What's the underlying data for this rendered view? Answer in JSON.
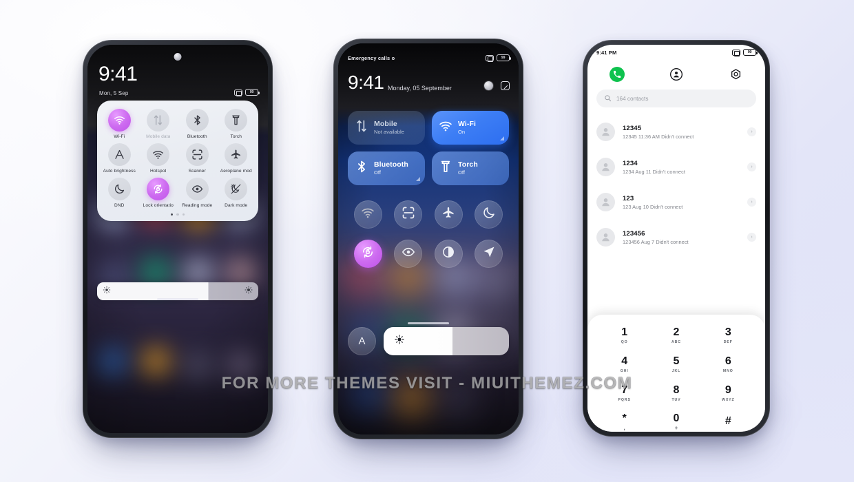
{
  "watermark": "FOR MORE THEMES VISIT - MIUITHEMEZ.COM",
  "colors": {
    "accent_purple": "#c055ea",
    "accent_blue": "#3d7ef5",
    "call_green": "#0ec24e",
    "page_background": "#e3e5f8"
  },
  "phone1": {
    "status": {
      "battery": "99",
      "alarm_icon": "alarm-icon",
      "battery_icon": "battery-icon"
    },
    "clock": "9:41",
    "date": "Mon, 5 Sep",
    "quick_settings": {
      "tiles": [
        {
          "label": "Wi-Fi",
          "icon": "wifi-icon",
          "state": "on",
          "has_arrow": true
        },
        {
          "label": "Mobile data",
          "icon": "mobile-data-icon",
          "state": "disabled",
          "has_arrow": false
        },
        {
          "label": "Bluetooth",
          "icon": "bluetooth-icon",
          "state": "off",
          "has_arrow": true
        },
        {
          "label": "Torch",
          "icon": "torch-icon",
          "state": "off",
          "has_arrow": false
        },
        {
          "label": "Auto brightness",
          "icon": "auto-brightness-icon",
          "state": "off",
          "has_arrow": false
        },
        {
          "label": "Hotspot",
          "icon": "hotspot-icon",
          "state": "off",
          "has_arrow": false
        },
        {
          "label": "Scanner",
          "icon": "scanner-icon",
          "state": "off",
          "has_arrow": false
        },
        {
          "label": "Aeroplane mod",
          "icon": "aeroplane-icon",
          "state": "off",
          "has_arrow": false
        },
        {
          "label": "DND",
          "icon": "moon-icon",
          "state": "off",
          "has_arrow": false
        },
        {
          "label": "Lock orientatio",
          "icon": "lock-rotation-icon",
          "state": "on",
          "has_arrow": false
        },
        {
          "label": "Reading mode",
          "icon": "eye-icon",
          "state": "off",
          "has_arrow": false
        },
        {
          "label": "Dark mode",
          "icon": "dark-mode-icon",
          "state": "off",
          "has_arrow": false
        }
      ],
      "page_dots": 3,
      "active_page": 1
    },
    "brightness": {
      "value_percent": 69,
      "left_icon": "auto-brightness-small-icon",
      "right_icon": "brightness-icon"
    }
  },
  "phone2": {
    "status": {
      "carrier": "Emergency calls o",
      "battery": "99"
    },
    "clock": "9:41",
    "date": "Monday, 05 September",
    "header_icons": [
      "camera-punch-icon",
      "edit-icon"
    ],
    "big_tiles": [
      {
        "title": "Mobile",
        "subtitle": "Not available",
        "icon": "mobile-data-icon",
        "state": "disabled",
        "has_arrow": false
      },
      {
        "title": "Wi-Fi",
        "subtitle": "On",
        "icon": "wifi-icon",
        "state": "active",
        "has_arrow": true
      },
      {
        "title": "Bluetooth",
        "subtitle": "Off",
        "icon": "bluetooth-icon",
        "state": "semi",
        "has_arrow": true
      },
      {
        "title": "Torch",
        "subtitle": "Off",
        "icon": "torch-icon",
        "state": "semi",
        "has_arrow": false
      }
    ],
    "round_tiles": [
      {
        "icon": "hotspot-icon",
        "state": "dim"
      },
      {
        "icon": "scanner-icon",
        "state": "off"
      },
      {
        "icon": "aeroplane-icon",
        "state": "off"
      },
      {
        "icon": "moon-icon",
        "state": "off"
      },
      {
        "icon": "lock-rotation-icon",
        "state": "on"
      },
      {
        "icon": "eye-icon",
        "state": "off"
      },
      {
        "icon": "contrast-icon",
        "state": "off"
      },
      {
        "icon": "location-icon",
        "state": "off"
      }
    ],
    "auto_brightness_label": "A",
    "brightness": {
      "value_percent": 55,
      "icon": "brightness-icon"
    }
  },
  "phone3": {
    "status": {
      "time": "9:41 PM",
      "battery": "99"
    },
    "tabs": [
      {
        "name": "calls",
        "icon": "phone-icon",
        "active": true
      },
      {
        "name": "contacts",
        "icon": "contact-icon",
        "active": false
      },
      {
        "name": "settings",
        "icon": "gear-icon",
        "active": false
      }
    ],
    "search": {
      "placeholder": "164 contacts",
      "icon": "search-icon"
    },
    "call_log": [
      {
        "name": "12345",
        "detail": "12345 11:36 AM Didn't connect"
      },
      {
        "name": "1234",
        "detail": "1234 Aug 11 Didn't connect"
      },
      {
        "name": "123",
        "detail": "123 Aug 10 Didn't connect"
      },
      {
        "name": "123456",
        "detail": "123456 Aug 7 Didn't connect"
      }
    ],
    "dialpad": [
      {
        "digit": "1",
        "letters": "QO",
        "big": false
      },
      {
        "digit": "2",
        "letters": "ABC",
        "big": false
      },
      {
        "digit": "3",
        "letters": "DEF",
        "big": false
      },
      {
        "digit": "4",
        "letters": "GHI",
        "big": false
      },
      {
        "digit": "5",
        "letters": "JKL",
        "big": false
      },
      {
        "digit": "6",
        "letters": "MNO",
        "big": false
      },
      {
        "digit": "7",
        "letters": "PQRS",
        "big": false
      },
      {
        "digit": "8",
        "letters": "TUV",
        "big": false
      },
      {
        "digit": "9",
        "letters": "WXYZ",
        "big": false
      },
      {
        "digit": "*",
        "letters": ",",
        "big": true
      },
      {
        "digit": "0",
        "letters": "+",
        "big": true
      },
      {
        "digit": "#",
        "letters": "",
        "big": false
      }
    ],
    "actions": {
      "menu_icon": "menu-icon",
      "call_icon": "phone-icon",
      "keypad_icon": "keypad-icon"
    }
  }
}
